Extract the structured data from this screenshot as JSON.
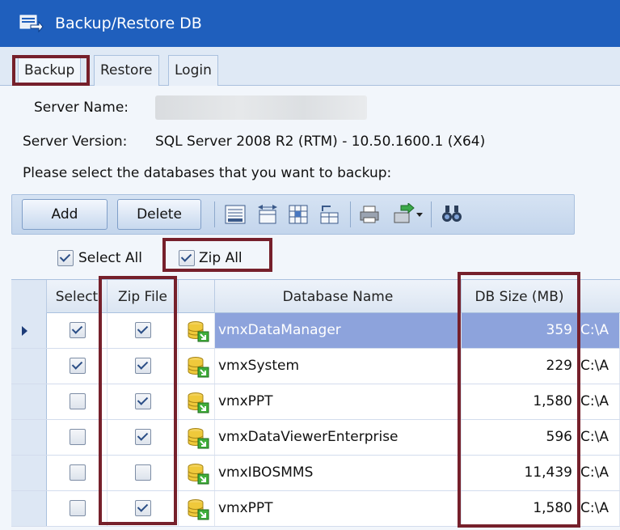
{
  "window": {
    "title": "Backup/Restore DB"
  },
  "tabs": [
    {
      "label": "Backup",
      "active": true
    },
    {
      "label": "Restore",
      "active": false
    },
    {
      "label": "Login",
      "active": false
    }
  ],
  "server": {
    "name_label": "Server Name:",
    "name_value": "",
    "version_label": "Server Version:",
    "version_value": "SQL Server 2008 R2 (RTM) - 10.50.1600.1 (X64)",
    "instructions": "Please select the databases that you want to backup:"
  },
  "toolbar": {
    "add_label": "Add",
    "delete_label": "Delete",
    "icons": [
      "details-icon",
      "expand-columns-icon",
      "grid-icon",
      "tree-grid-icon",
      "print-icon",
      "export-icon",
      "find-icon"
    ]
  },
  "options": {
    "select_all_label": "Select All",
    "select_all_checked": true,
    "zip_all_label": "Zip All",
    "zip_all_checked": true
  },
  "grid": {
    "columns": [
      "Select",
      "Zip File",
      "",
      "Database Name",
      "DB Size (MB)",
      ""
    ],
    "rows": [
      {
        "select": true,
        "zip": true,
        "name": "vmxDataManager",
        "size": "359",
        "path": "C:\\A",
        "current": true
      },
      {
        "select": true,
        "zip": true,
        "name": "vmxSystem",
        "size": "229",
        "path": "C:\\A",
        "current": false
      },
      {
        "select": false,
        "zip": true,
        "name": "vmxPPT",
        "size": "1,580",
        "path": "C:\\A",
        "current": false
      },
      {
        "select": false,
        "zip": true,
        "name": "vmxDataViewerEnterprise",
        "size": "596",
        "path": "C:\\A",
        "current": false
      },
      {
        "select": false,
        "zip": false,
        "name": "vmxIBOSMMS",
        "size": "11,439",
        "path": "C:\\A",
        "current": false
      },
      {
        "select": false,
        "zip": true,
        "name": "vmxPPT",
        "size": "1,580",
        "path": "C:\\A",
        "current": false
      }
    ]
  },
  "colors": {
    "titlebar": "#1f5fbd",
    "highlight_box": "#76202b",
    "selected_row": "#8da3dc"
  }
}
